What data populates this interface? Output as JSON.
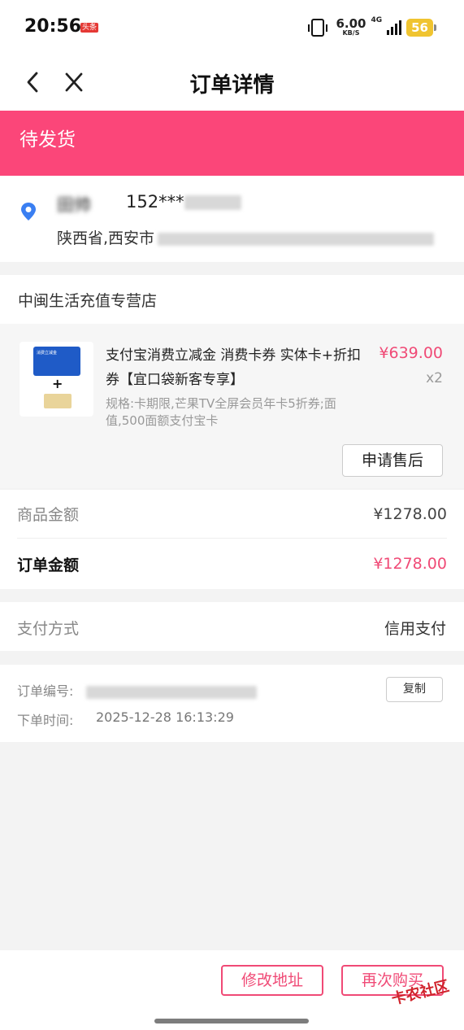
{
  "status_bar": {
    "time": "20:56",
    "badge": "头条",
    "net_speed": "6.00",
    "net_unit": "KB/S",
    "net_type": "4G",
    "battery": "56"
  },
  "nav": {
    "title": "订单详情"
  },
  "order_status": "待发货",
  "address": {
    "name": "田帅",
    "phone": "152***",
    "line": "陕西省,西安市"
  },
  "store": {
    "name": "中闽生活充值专营店"
  },
  "product": {
    "title": "支付宝消费立减金 消费卡券 实体卡+折扣券【宜口袋新客专享】",
    "price": "¥639.00",
    "quantity": "x2",
    "spec": "规格:卡期限,芒果TV全屏会员年卡5折券;面值,500面额支付宝卡",
    "aftersale_label": "申请售后",
    "thumb_label": "消费立减金"
  },
  "amounts": {
    "goods_label": "商品金额",
    "goods_value": "¥1278.00",
    "order_label": "订单金额",
    "order_value": "¥1278.00"
  },
  "payment": {
    "label": "支付方式",
    "value": "信用支付"
  },
  "order_info": {
    "number_label": "订单编号:",
    "copy_label": "复制",
    "time_label": "下单时间:",
    "time_value": "2025-12-28 16:13:29"
  },
  "bottom": {
    "edit_address_label": "修改地址",
    "rebuy_label": "再次购买"
  },
  "watermark_text": "卡农社区",
  "colors": {
    "accent": "#fb4679",
    "price": "#f04a76",
    "location": "#3a7ff2"
  }
}
